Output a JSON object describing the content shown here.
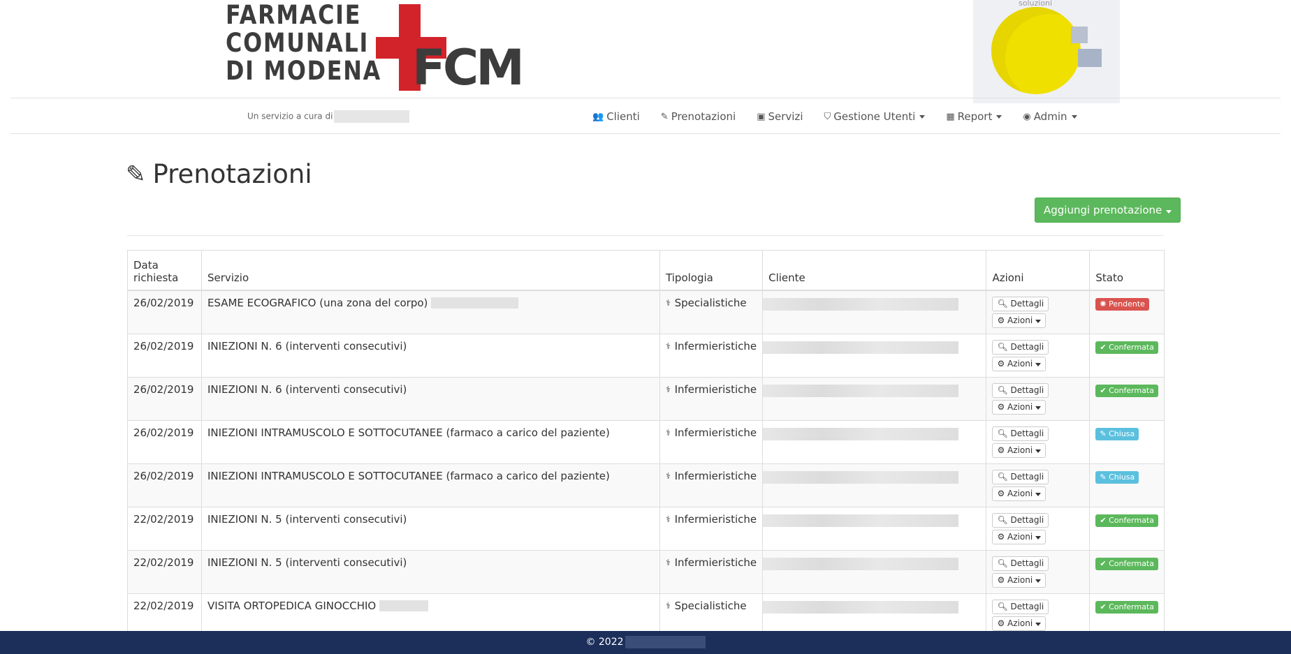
{
  "header": {
    "logo_lines": [
      "FARMACIE",
      "COMUNALI",
      "DI MODENA"
    ],
    "logo_mark": "FCM",
    "partner_logo_tag": "soluzioni",
    "service_by": "Un servizio a cura di"
  },
  "nav": [
    {
      "icon": "users-icon",
      "glyph": "👥",
      "label": "Clienti",
      "dropdown": false
    },
    {
      "icon": "edit-icon",
      "glyph": "✎",
      "label": "Prenotazioni",
      "dropdown": false
    },
    {
      "icon": "services-icon",
      "glyph": "▣",
      "label": "Servizi",
      "dropdown": false
    },
    {
      "icon": "shield-icon",
      "glyph": "⛉",
      "label": "Gestione Utenti",
      "dropdown": true
    },
    {
      "icon": "grid-icon",
      "glyph": "▦",
      "label": "Report",
      "dropdown": true
    },
    {
      "icon": "user-circle-icon",
      "glyph": "◉",
      "label": "Admin",
      "dropdown": true
    }
  ],
  "page": {
    "title": "Prenotazioni",
    "add_button": "Aggiungi prenotazione"
  },
  "table": {
    "headers": [
      "Data richiesta",
      "Servizio",
      "Tipologia",
      "Cliente",
      "Azioni",
      "Stato"
    ],
    "details_label": "Dettagli",
    "actions_label": "Azioni",
    "rows": [
      {
        "date": "26/02/2019",
        "service": "ESAME ECOGRAFICO (una zona del corpo)",
        "redacted": true,
        "type": "Specialistiche",
        "type_icon": "user-md-icon",
        "status": "Pendente",
        "status_kind": "danger",
        "status_icon": "spinner-icon"
      },
      {
        "date": "26/02/2019",
        "service": "INIEZIONI N. 6 (interventi consecutivi)",
        "redacted": false,
        "type": "Infermieristiche",
        "type_icon": "stethoscope-icon",
        "status": "Confermata",
        "status_kind": "success",
        "status_icon": "check-icon"
      },
      {
        "date": "26/02/2019",
        "service": "INIEZIONI N. 6 (interventi consecutivi)",
        "redacted": false,
        "type": "Infermieristiche",
        "type_icon": "stethoscope-icon",
        "status": "Confermata",
        "status_kind": "success",
        "status_icon": "check-icon"
      },
      {
        "date": "26/02/2019",
        "service": "INIEZIONI INTRAMUSCOLO E SOTTOCUTANEE (farmaco a carico del paziente)",
        "redacted": false,
        "type": "Infermieristiche",
        "type_icon": "stethoscope-icon",
        "status": "Chiusa",
        "status_kind": "info",
        "status_icon": "edit-icon"
      },
      {
        "date": "26/02/2019",
        "service": "INIEZIONI INTRAMUSCOLO E SOTTOCUTANEE (farmaco a carico del paziente)",
        "redacted": false,
        "type": "Infermieristiche",
        "type_icon": "stethoscope-icon",
        "status": "Chiusa",
        "status_kind": "info",
        "status_icon": "edit-icon"
      },
      {
        "date": "22/02/2019",
        "service": "INIEZIONI N. 5 (interventi consecutivi)",
        "redacted": false,
        "type": "Infermieristiche",
        "type_icon": "stethoscope-icon",
        "status": "Confermata",
        "status_kind": "success",
        "status_icon": "check-icon"
      },
      {
        "date": "22/02/2019",
        "service": "INIEZIONI N. 5 (interventi consecutivi)",
        "redacted": false,
        "type": "Infermieristiche",
        "type_icon": "stethoscope-icon",
        "status": "Confermata",
        "status_kind": "success",
        "status_icon": "check-icon"
      },
      {
        "date": "22/02/2019",
        "service": "VISITA ORTOPEDICA GINOCCHIO",
        "redacted": true,
        "type": "Specialistiche",
        "type_icon": "user-md-icon",
        "status": "Confermata",
        "status_kind": "success",
        "status_icon": "check-icon"
      }
    ]
  },
  "footer": {
    "copyright": "© 2022"
  },
  "colors": {
    "brand_red": "#d2232a",
    "primary_green": "#5cb85c",
    "danger": "#d9534f",
    "info": "#5bc0de",
    "footer_bg": "#1c2f5a"
  }
}
